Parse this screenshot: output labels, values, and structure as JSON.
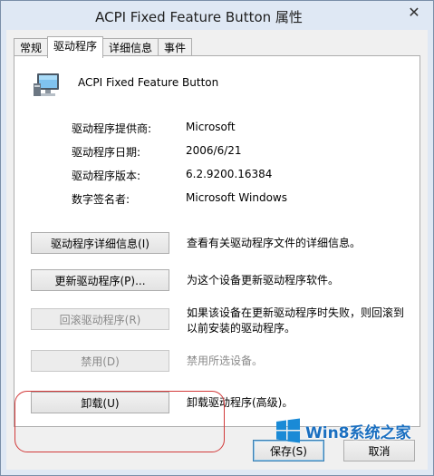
{
  "window": {
    "title": "ACPI Fixed Feature Button 属性"
  },
  "tabs": [
    "常规",
    "驱动程序",
    "详细信息",
    "事件"
  ],
  "device": {
    "name": "ACPI Fixed Feature Button"
  },
  "info": [
    {
      "label": "驱动程序提供商:",
      "value": "Microsoft"
    },
    {
      "label": "驱动程序日期:",
      "value": "2006/6/21"
    },
    {
      "label": "驱动程序版本:",
      "value": "6.2.9200.16384"
    },
    {
      "label": "数字签名者:",
      "value": "Microsoft Windows"
    }
  ],
  "actions": [
    {
      "button": "驱动程序详细信息(I)",
      "desc": "查看有关驱动程序文件的详细信息。"
    },
    {
      "button": "更新驱动程序(P)...",
      "desc": "为这个设备更新驱动程序软件。"
    },
    {
      "button": "回滚驱动程序(R)",
      "desc": "如果该设备在更新驱动程序时失败，则回滚到以前安装的驱动程序。"
    },
    {
      "button": "禁用(D)",
      "desc": "禁用所选设备。"
    },
    {
      "button": "卸载(U)",
      "desc": "卸载驱动程序(高级)。"
    }
  ],
  "footer": {
    "ok": "保存(S)",
    "cancel": "取消"
  },
  "watermark": {
    "text": "Win8系统之家"
  },
  "colors": {
    "highlight": "#d23a3a",
    "watermark": "#1a6fc0"
  }
}
